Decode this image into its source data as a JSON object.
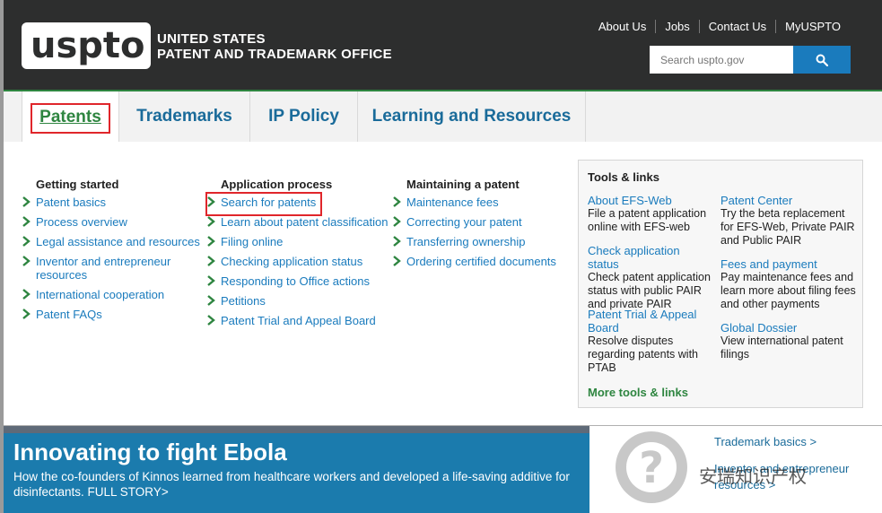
{
  "header": {
    "logo_text": "uspto",
    "agency_line1": "UNITED STATES",
    "agency_line2": "PATENT AND TRADEMARK OFFICE",
    "utility_links": [
      "About Us",
      "Jobs",
      "Contact Us",
      "MyUSPTO"
    ],
    "search_placeholder": "Search uspto.gov",
    "search_icon": "search-icon"
  },
  "nav": {
    "tabs": [
      "Patents",
      "Trademarks",
      "IP Policy",
      "Learning and Resources"
    ],
    "active": "Patents"
  },
  "mega_menu": {
    "columns": [
      {
        "title": "Getting started",
        "items": [
          "Patent basics",
          "Process overview",
          "Legal assistance and resources",
          "Inventor and entrepreneur resources",
          "International cooperation",
          "Patent FAQs"
        ]
      },
      {
        "title": "Application process",
        "items": [
          "Search for patents",
          "Learn about patent classification",
          "Filing online",
          "Checking application status",
          "Responding to Office actions",
          "Petitions",
          "Patent Trial and Appeal Board"
        ]
      },
      {
        "title": "Maintaining a patent",
        "items": [
          "Maintenance fees",
          "Correcting your patent",
          "Transferring ownership",
          "Ordering certified documents"
        ]
      }
    ],
    "tools": {
      "title": "Tools & links",
      "items": [
        {
          "link": "About EFS-Web",
          "desc": "File a patent application online with EFS-web"
        },
        {
          "link": "Check application status",
          "desc": "Check patent application status with public PAIR and private PAIR"
        },
        {
          "link": "Patent Trial & Appeal Board",
          "desc": "Resolve disputes regarding patents with PTAB"
        },
        {
          "link": "Patent Center",
          "desc": "Try the beta replacement for EFS-Web, Private PAIR and Public PAIR"
        },
        {
          "link": "Fees and payment",
          "desc": "Pay maintenance fees and learn more about filing fees and other payments"
        },
        {
          "link": "Global Dossier",
          "desc": "View international patent filings"
        }
      ],
      "more": "More tools & links"
    }
  },
  "hero": {
    "title": "Innovating to fight Ebola",
    "desc": "How the co-founders of Kinnos learned from healthcare workers and developed a life-saving additive for disinfectants. FULL STORY>"
  },
  "side": {
    "link1": "Trademark basics >",
    "link2_a": "Inventor and entrepreneur",
    "link2_b": "resources >",
    "watermark": "安瑞知识产权"
  },
  "colors": {
    "header_bg": "#2d2e2e",
    "accent_green": "#2e8540",
    "link_blue": "#1a7bbd",
    "highlight_red": "#e0262b",
    "hero_blue": "#1b7bad"
  }
}
